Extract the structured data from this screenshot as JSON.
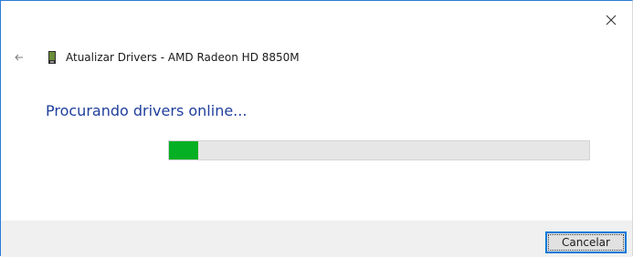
{
  "window": {
    "title": "Atualizar Drivers - AMD Radeon HD 8850M",
    "close_icon": "close-icon",
    "back_icon": "back-arrow-icon",
    "device_icon": "display-adapter-icon"
  },
  "main": {
    "heading": "Procurando drivers online...",
    "progress_fraction": 0.07
  },
  "footer": {
    "cancel_label": "Cancelar"
  },
  "colors": {
    "heading": "#1f3f9c",
    "progress_fill": "#06b025",
    "progress_track": "#e6e6e6",
    "accent": "#0078d7"
  }
}
